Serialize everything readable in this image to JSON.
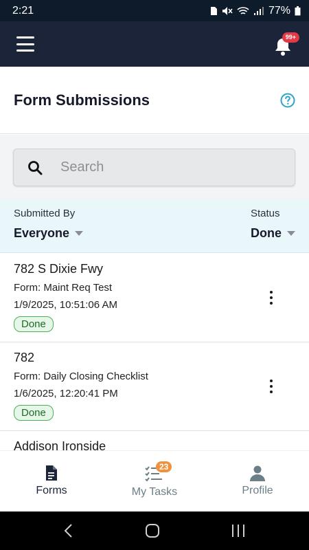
{
  "status_bar": {
    "time": "2:21",
    "battery": "77%"
  },
  "header": {
    "notification_count": "99+"
  },
  "page": {
    "title": "Form Submissions"
  },
  "search": {
    "placeholder": "Search",
    "value": ""
  },
  "filters": {
    "submitted_by_label": "Submitted By",
    "submitted_by_value": "Everyone",
    "status_label": "Status",
    "status_value": "Done"
  },
  "submissions": [
    {
      "title": "782 S Dixie Fwy",
      "form": "Form: Maint Req Test",
      "date": "1/9/2025, 10:51:06 AM",
      "status": "Done"
    },
    {
      "title": "782",
      "form": "Form: Daily Closing Checklist",
      "date": "1/6/2025, 12:20:41 PM",
      "status": "Done"
    },
    {
      "title": "Addison Ironside"
    }
  ],
  "bottom_nav": {
    "forms_label": "Forms",
    "tasks_label": "My Tasks",
    "tasks_count": "23",
    "profile_label": "Profile"
  },
  "colors": {
    "app_bar": "#1b2438",
    "filter_bg": "#eaf7fa",
    "done_badge": "#e6f6e8",
    "notification_badge": "#e53946",
    "tasks_badge": "#f0923d",
    "help_icon": "#2aa3c9"
  }
}
